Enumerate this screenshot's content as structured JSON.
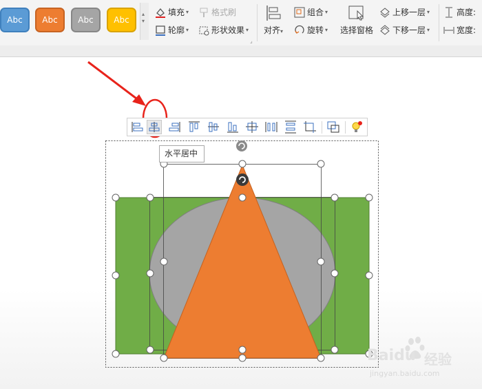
{
  "ribbon": {
    "style_buttons": [
      {
        "label": "Abc",
        "color": "#5b9bd5"
      },
      {
        "label": "Abc",
        "color": "#ed7d31"
      },
      {
        "label": "Abc",
        "color": "#a5a5a5"
      },
      {
        "label": "Abc",
        "color": "#ffc000"
      }
    ],
    "fill_label": "填充",
    "format_brush_label": "格式刷",
    "outline_label": "轮廓",
    "shape_effect_label": "形状效果",
    "align_label": "对齐",
    "group_label": "组合",
    "rotate_label": "旋转",
    "selection_pane_label": "选择窗格",
    "bring_forward_label": "上移一层",
    "send_backward_label": "下移一层",
    "height_label": "高度:",
    "width_label": "宽度:"
  },
  "align_toolbar": {
    "buttons": [
      "align-left-icon",
      "align-center-horizontal-icon",
      "align-right-icon",
      "align-top-icon",
      "align-middle-vertical-icon",
      "align-bottom-icon",
      "align-center-both-icon",
      "distribute-horizontal-icon",
      "distribute-vertical-icon",
      "crop-canvas-icon",
      "group-icon",
      "smart-tip-icon"
    ],
    "active_index": 1
  },
  "tooltip": {
    "text": "水平居中"
  },
  "shapes": {
    "rectangle_color": "#70ad47",
    "ellipse_color": "#a5a5a5",
    "triangle_color": "#ed7d31"
  },
  "annotation": {
    "color": "#e8231b"
  },
  "watermark": {
    "brand": "Baidu",
    "brand_cn": "经验",
    "url": "jingyan.baidu.com"
  }
}
